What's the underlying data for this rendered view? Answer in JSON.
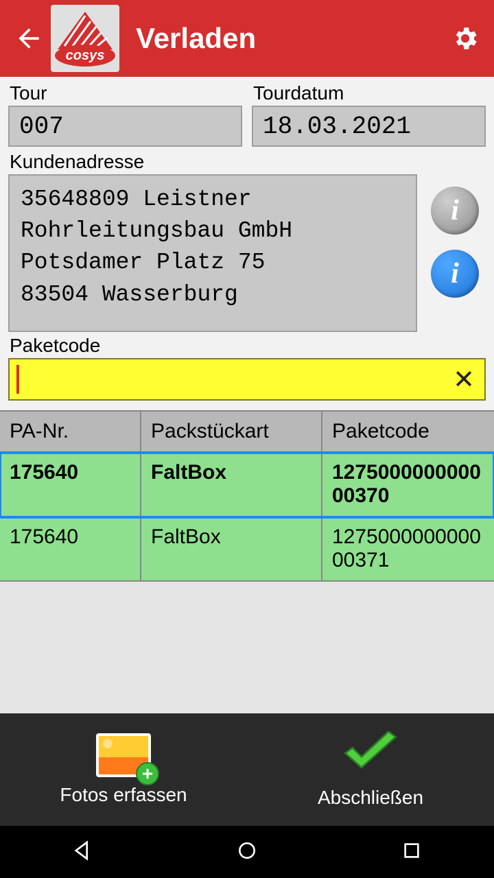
{
  "header": {
    "title": "Verladen"
  },
  "form": {
    "tour_label": "Tour",
    "tour_value": "007",
    "tourdatum_label": "Tourdatum",
    "tourdatum_value": "18.03.2021",
    "kundenadresse_label": "Kundenadresse",
    "address": "35648809 Leistner\nRohrleitungsbau GmbH\nPotsdamer Platz 75\n83504 Wasserburg",
    "paketcode_label": "Paketcode",
    "paketcode_value": ""
  },
  "table": {
    "headers": {
      "pa_nr": "PA-Nr.",
      "packstueckart": "Packstückart",
      "paketcode": "Paketcode"
    },
    "rows": [
      {
        "pa_nr": "175640",
        "packstueckart": "FaltBox",
        "paketcode": "127500000000000370",
        "selected": true
      },
      {
        "pa_nr": "175640",
        "packstueckart": "FaltBox",
        "paketcode": "127500000000000371",
        "selected": false
      }
    ]
  },
  "bottom": {
    "fotos": "Fotos erfassen",
    "abschliessen": "Abschließen"
  }
}
